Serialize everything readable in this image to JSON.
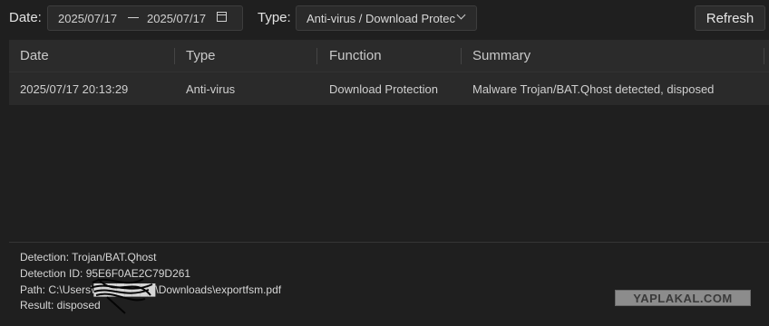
{
  "filters": {
    "date_label": "Date:",
    "date_from": "2025/07/17",
    "date_to": "2025/07/17",
    "type_label": "Type:",
    "type_value": "Anti-virus / Download Protection",
    "refresh_label": "Refresh"
  },
  "table": {
    "columns": [
      "Date",
      "Type",
      "Function",
      "Summary"
    ],
    "rows": [
      {
        "date": "2025/07/17 20:13:29",
        "type": "Anti-virus",
        "function": "Download Protection",
        "summary": "Malware Trojan/BAT.Qhost detected, disposed"
      }
    ]
  },
  "details": {
    "detection": "Detection: Trojan/BAT.Qhost",
    "detection_id": "Detection ID: 95E6F0AE2C79D261",
    "path": "Path: C:\\Users\\████████\\Downloads\\exportfsm.pdf",
    "result": "Result: disposed"
  },
  "watermark": "YAPLAKAL.COM"
}
